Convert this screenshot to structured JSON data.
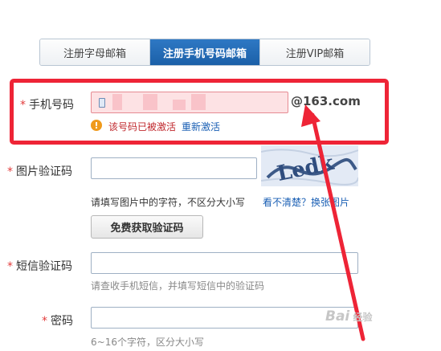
{
  "tabs": [
    {
      "label": "注册字母邮箱"
    },
    {
      "label": "注册手机号码邮箱"
    },
    {
      "label": "注册VIP邮箱"
    }
  ],
  "phone": {
    "label": "手机号码",
    "required_mark": "*",
    "suffix": "@163.com",
    "error_text": "该号码已被激活",
    "error_icon": "!",
    "reactivate_link": "重新激活"
  },
  "captcha": {
    "label": "图片验证码",
    "required_mark": "*",
    "hint": "请填写图片中的字符，不区分大小写",
    "refresh_link": "看不清楚？换张图片",
    "image_text": "Ledk"
  },
  "get_code_button": "免费获取验证码",
  "sms": {
    "label": "短信验证码",
    "required_mark": "*",
    "hint": "请查收手机短信，并填写短信中的验证码"
  },
  "password": {
    "label": "密码",
    "required_mark": "*",
    "hint": "6~16个字符，区分大小写"
  },
  "watermark": {
    "logo": "Bai",
    "text": "经验"
  },
  "colors": {
    "highlight_box": "#ee2436",
    "arrow": "#ee2436",
    "active_tab": "#1f67b1"
  }
}
